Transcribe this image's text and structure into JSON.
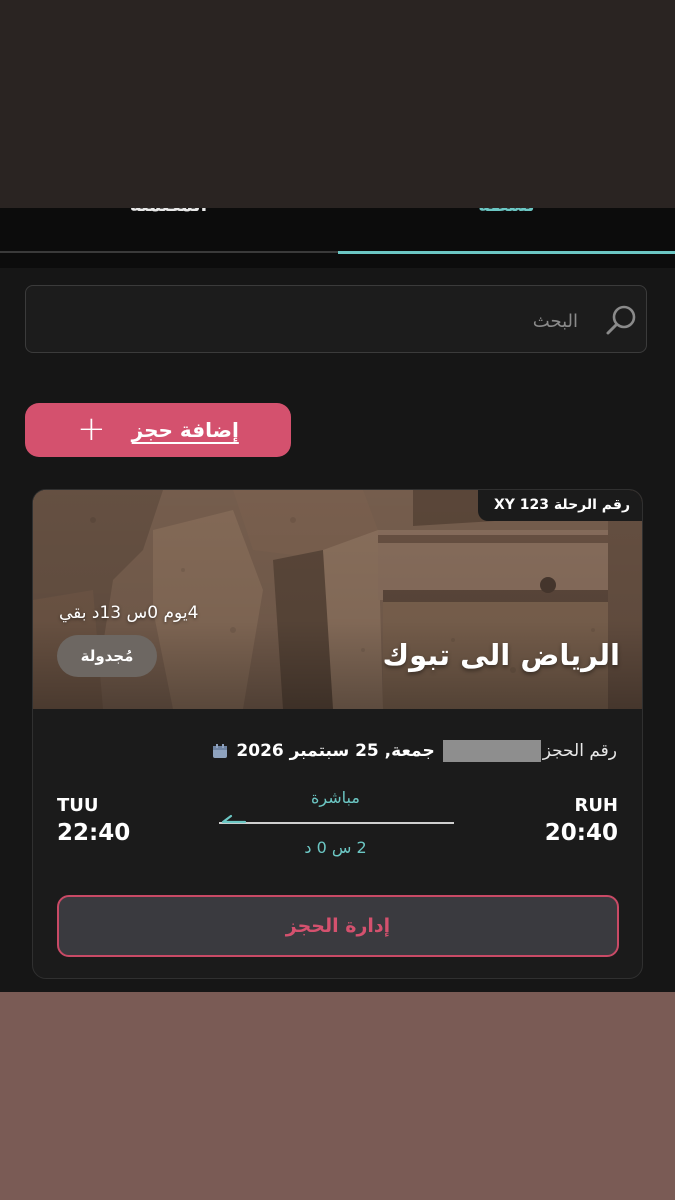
{
  "tabs": {
    "completed_label": "المكتملة",
    "active_label": "نشطة"
  },
  "search": {
    "placeholder": "البحث",
    "icon": "search-icon"
  },
  "add_booking": {
    "label": "إضافة حجز",
    "icon": "plus-icon"
  },
  "trip_card": {
    "flight_number": "رقم الرحلة XY 123",
    "countdown": "4يوم 0س 13د بقي",
    "status": "مُجدولة",
    "route_title": "الرياض الى تبوك",
    "booking_label": "رقم الحجز",
    "date": "جمعة, 25 سبتمبر 2026",
    "calendar_icon": "calendar-icon",
    "departure": {
      "code": "RUH",
      "time": "20:40"
    },
    "arrival": {
      "code": "TUU",
      "time": "22:40"
    },
    "stops": "مباشرة",
    "duration": "2 س 0 د",
    "manage_label": "إدارة الحجز"
  },
  "colors": {
    "accent_teal": "#6cc7c4",
    "accent_pink": "#d4516e",
    "background": "#161616"
  }
}
